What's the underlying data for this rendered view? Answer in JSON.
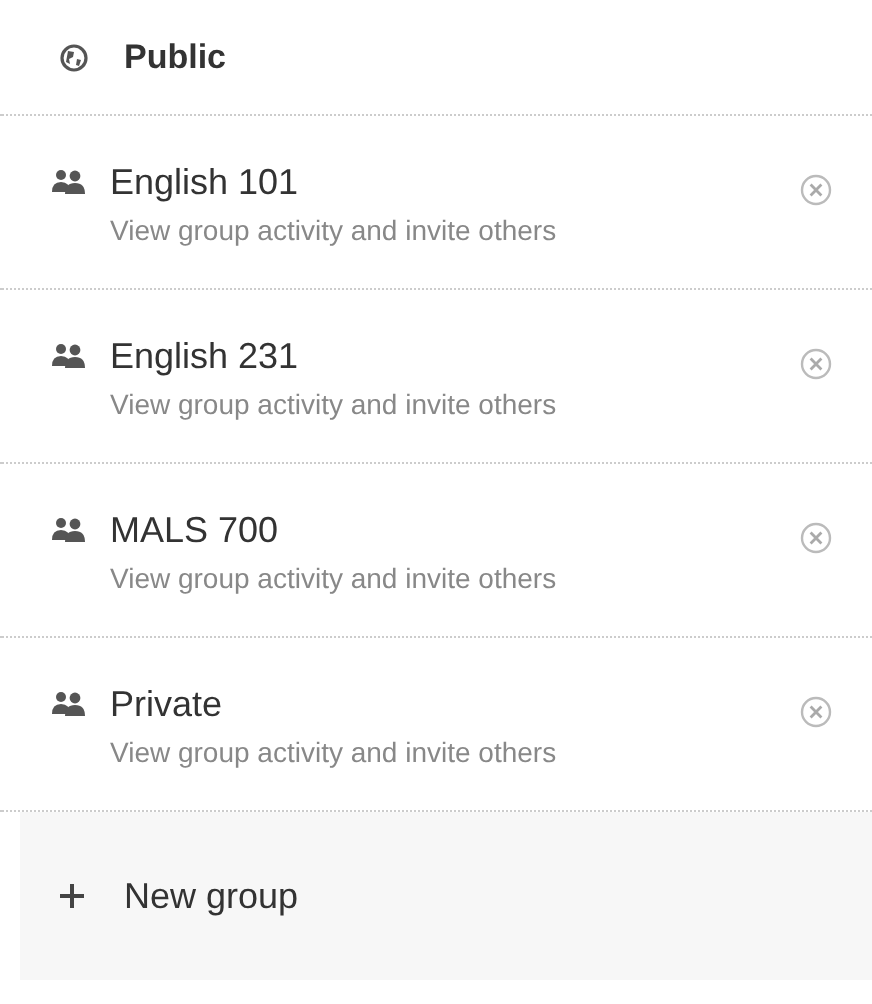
{
  "header": {
    "title": "Public"
  },
  "groups": [
    {
      "name": "English 101",
      "subtitle": "View group activity and invite others"
    },
    {
      "name": "English 231",
      "subtitle": "View group activity and invite others"
    },
    {
      "name": "MALS 700",
      "subtitle": "View group activity and invite others"
    },
    {
      "name": "Private",
      "subtitle": "View group activity and invite others"
    }
  ],
  "new_group": {
    "label": "New group"
  }
}
